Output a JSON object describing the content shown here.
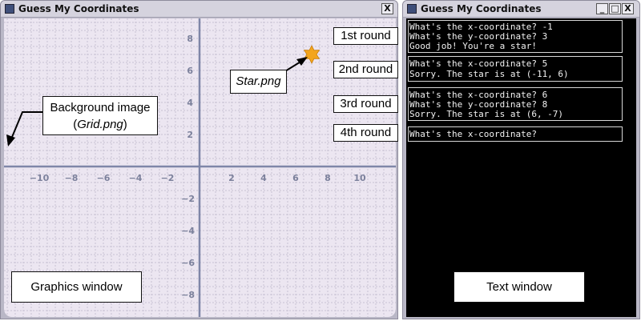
{
  "graphics_window": {
    "title": "Guess My Coordinates",
    "close_label": "X",
    "x_ticks": [
      "−10",
      "−8",
      "−6",
      "−4",
      "−2",
      "2",
      "4",
      "6",
      "8",
      "10"
    ],
    "y_ticks_pos": [
      "8",
      "6",
      "4",
      "2"
    ],
    "y_ticks_neg": [
      "−2",
      "−4",
      "−6",
      "−8"
    ],
    "star_position": {
      "x": 7,
      "y": 7
    },
    "star_icon": "star-icon"
  },
  "text_window": {
    "title": "Guess My Coordinates",
    "buttons": {
      "minimize": "_",
      "maximize": "□",
      "close": "X"
    },
    "lines": [
      "What's the x-coordinate? -1",
      "What's the y-coordinate? 3",
      "Good job! You're a star!",
      "What's the x-coordinate? 5",
      "Sorry. The star is at (-11, 6)",
      "What's the x-coordinate? 6",
      "What's the y-coordinate? 8",
      "Sorry. The star is at (6, -7)",
      "What's the x-coordinate? "
    ]
  },
  "callouts": {
    "background_image_line1": "Background image",
    "background_image_line2": "Grid.png",
    "star_file": "Star.png",
    "graphics_window": "Graphics window",
    "text_window": "Text window",
    "rounds": [
      "1st round",
      "2nd round",
      "3rd round",
      "4th round"
    ]
  },
  "colors": {
    "grid_bg": "#ece6f1",
    "grid_line": "#c9c3d4",
    "axis": "#7f86a8",
    "tick_label": "#7c819c",
    "star": "#f3a51c"
  }
}
